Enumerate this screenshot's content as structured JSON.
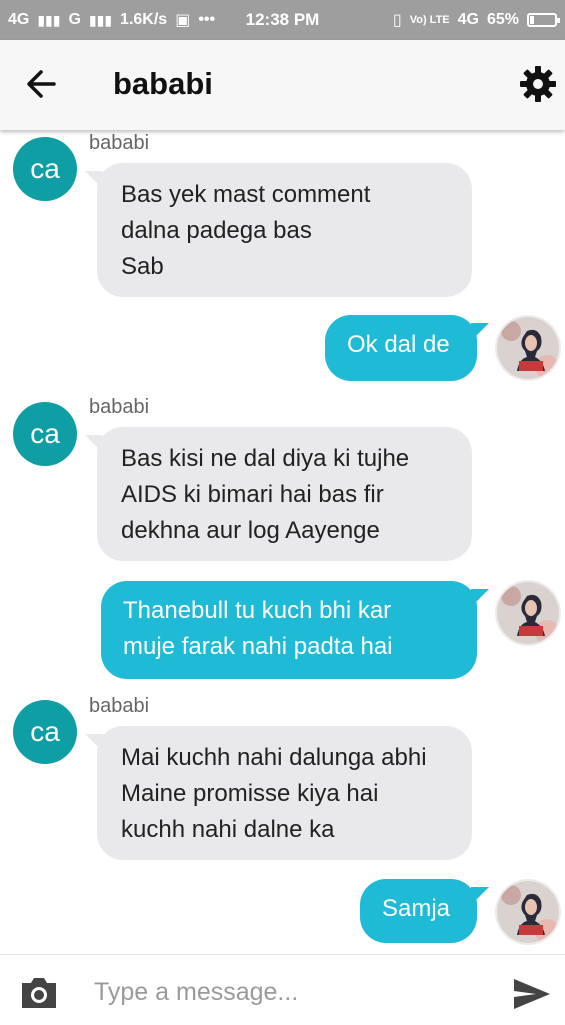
{
  "status_bar": {
    "net1": "4G",
    "net2": "G",
    "speed": "1.6K/s",
    "dots": "•••",
    "time": "12:38 PM",
    "volte": "Vo) LTE",
    "net3": "4G",
    "battery": "65%"
  },
  "header": {
    "title": "bababi"
  },
  "messages": [
    {
      "direction": "in",
      "avatar_text": "ca",
      "sender": "bababi",
      "lines": [
        "Bas yek mast comment",
        "dalna padega bas",
        "Sab"
      ]
    },
    {
      "direction": "out",
      "lines": [
        "Ok dal de"
      ]
    },
    {
      "direction": "in",
      "avatar_text": "ca",
      "sender": "bababi",
      "lines": [
        "Bas kisi ne dal diya ki tujhe",
        "AIDS ki bimari hai bas fir",
        "dekhna aur log Aayenge"
      ]
    },
    {
      "direction": "out",
      "lines": [
        "Thanebull tu kuch bhi kar",
        "muje farak nahi padta hai"
      ]
    },
    {
      "direction": "in",
      "avatar_text": "ca",
      "sender": "bababi",
      "lines": [
        "Mai kuchh nahi dalunga abhi",
        "Maine promisse kiya hai",
        "kuchh nahi dalne ka"
      ]
    },
    {
      "direction": "out",
      "lines": [
        "Samja"
      ]
    }
  ],
  "composer": {
    "placeholder": "Type a message..."
  },
  "colors": {
    "incoming_bubble": "#e9e9eb",
    "outgoing_bubble": "#1fbad6",
    "avatar_teal": "#0e9ea3",
    "status_bar": "#9e9e9e"
  },
  "icons": {
    "back": "arrow-left-icon",
    "settings": "gear-icon",
    "camera": "camera-icon",
    "send": "send-icon"
  }
}
